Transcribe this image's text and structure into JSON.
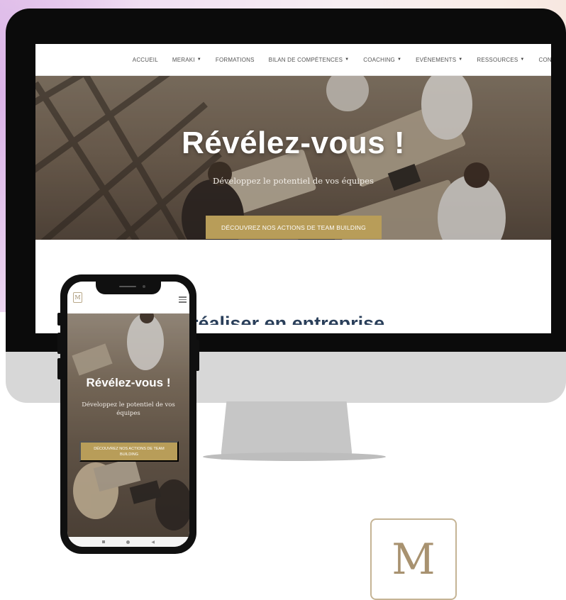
{
  "desktop": {
    "nav": {
      "items": [
        {
          "label": "ACCUEIL",
          "has_dropdown": false
        },
        {
          "label": "MERAKI",
          "has_dropdown": true
        },
        {
          "label": "FORMATIONS",
          "has_dropdown": false
        },
        {
          "label": "BILAN DE COMPÉTENCES",
          "has_dropdown": true
        },
        {
          "label": "COACHING",
          "has_dropdown": true
        },
        {
          "label": "EVÉNEMENTS",
          "has_dropdown": true
        },
        {
          "label": "RESSOURCES",
          "has_dropdown": true
        },
        {
          "label": "CONT",
          "has_dropdown": false
        }
      ]
    },
    "hero": {
      "title": "Révélez-vous !",
      "subtitle": "Développez le potentiel de vos équipes",
      "cta_label": "DÉCOUVREZ NOS ACTIONS DE TEAM BUILDING"
    },
    "section_title_partial": "réaliser en entreprise"
  },
  "mobile": {
    "logo_letter": "M",
    "hero": {
      "title": "Révélez-vous !",
      "subtitle": "Développez le potentiel de vos équipes",
      "cta_label": "DÉCOUVREZ NOS ACTIONS DE TEAM BUILDING"
    }
  },
  "brand_logo": {
    "letter": "M"
  },
  "icons": {
    "dropdown": "chevron-down-icon",
    "menu": "hamburger-menu-icon"
  },
  "colors": {
    "accent_gold": "#b89d59",
    "section_title": "#2a3f5a"
  }
}
